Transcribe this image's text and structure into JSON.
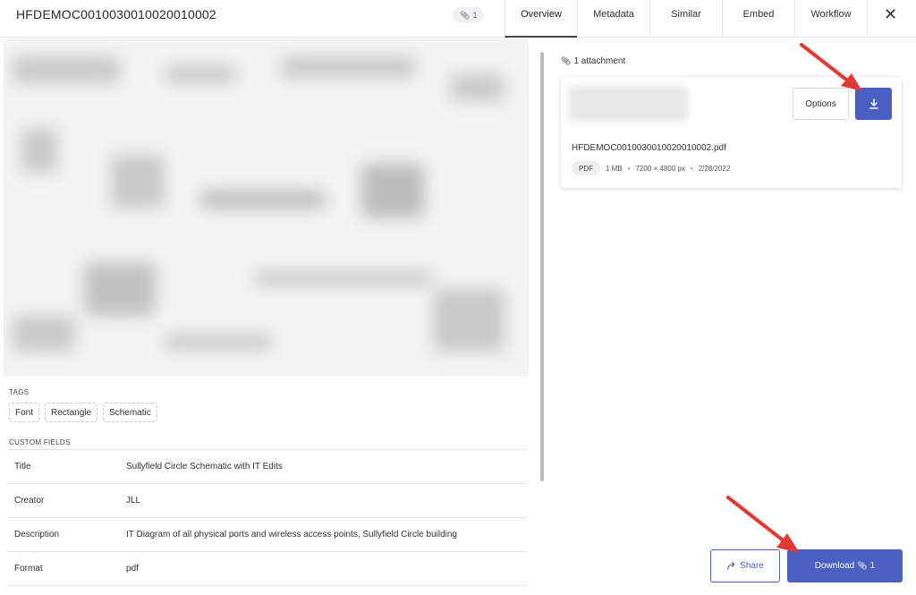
{
  "header": {
    "title": "HFDEMOC0010030010020010002",
    "attachment_badge": "1",
    "tabs": [
      {
        "label": "Overview",
        "active": true
      },
      {
        "label": "Metadata"
      },
      {
        "label": "Similar"
      },
      {
        "label": "Embed"
      },
      {
        "label": "Workflow"
      }
    ],
    "close_icon": "close-icon"
  },
  "left": {
    "tags_label": "TAGS",
    "tags": [
      "Font",
      "Rectangle",
      "Schematic"
    ],
    "custom_fields_label": "CUSTOM FIELDS",
    "fields": [
      {
        "name": "Title",
        "value": "Sullyfield Circle Schematic with IT Edits"
      },
      {
        "name": "Creator",
        "value": "JLL"
      },
      {
        "name": "Description",
        "value": "IT Diagram of all physical ports and wireless access points, Sullyfield Circle building"
      },
      {
        "name": "Format",
        "value": "pdf"
      }
    ]
  },
  "right": {
    "attachments_count": "1 attachment",
    "card": {
      "options_label": "Options",
      "filename": "HFDEMOC0010030010020010002.pdf",
      "type": "PDF",
      "size": "1 MB",
      "dimensions": "7200 × 4800 px",
      "date": "2/28/2022"
    },
    "share_label": "Share",
    "download_label": "Download",
    "download_count": "1"
  },
  "colors": {
    "accent": "#4a5fc1",
    "arrow": "#e53935"
  }
}
